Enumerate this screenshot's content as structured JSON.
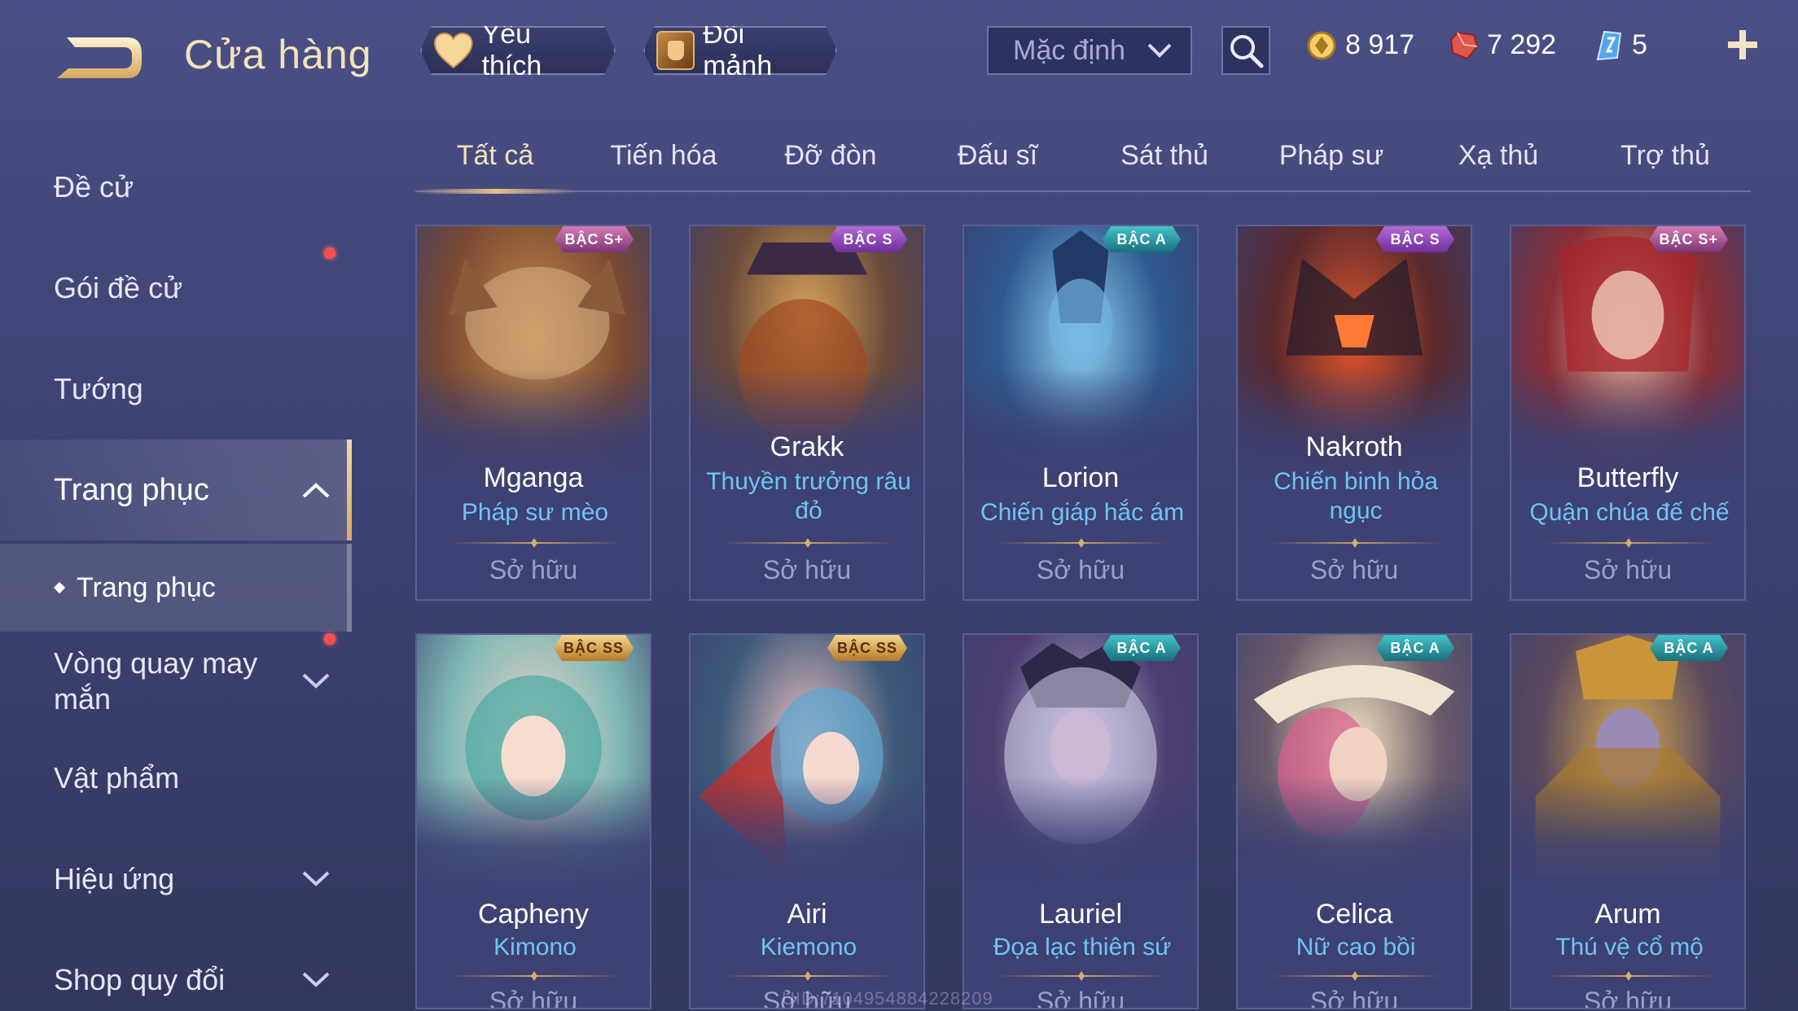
{
  "header": {
    "title": "Cửa hàng",
    "favorites_label": "Yêu thích",
    "fragments_label": "Đổi mảnh",
    "sort_selected": "Mặc định",
    "currencies": [
      {
        "icon": "gold-coin-icon",
        "value": "8 917"
      },
      {
        "icon": "ruby-icon",
        "value": "7 292"
      },
      {
        "icon": "crystal-icon",
        "value": "5"
      }
    ]
  },
  "sidebar": {
    "items": [
      {
        "label": "Đề cử"
      },
      {
        "label": "Gói đề cử",
        "dot": true
      },
      {
        "label": "Tướng"
      },
      {
        "label": "Trang phục",
        "expanded": true
      },
      {
        "label": "Vòng quay may mắn",
        "dot": true
      },
      {
        "label": "Vật phẩm"
      },
      {
        "label": "Hiệu ứng"
      },
      {
        "label": "Shop quy đổi"
      }
    ],
    "sub_active": "Trang phục"
  },
  "tabs": [
    "Tất cả",
    "Tiến hóa",
    "Đỡ đòn",
    "Đấu sĩ",
    "Sát thủ",
    "Pháp sư",
    "Xạ thủ",
    "Trợ thủ"
  ],
  "active_tab": "Tất cả",
  "cards": [
    {
      "badge": "BẬC S+",
      "hero": "Mganga",
      "skin": "Pháp sư mèo",
      "status": "Sở hữu",
      "badge_color": "#d77bb5"
    },
    {
      "badge": "BẬC S",
      "hero": "Grakk",
      "skin": "Thuyền trưởng râu đỏ",
      "status": "Sở hữu",
      "badge_color": "#b36ad6"
    },
    {
      "badge": "BẬC A",
      "hero": "Lorion",
      "skin": "Chiến giáp hắc ám",
      "status": "Sở hữu",
      "badge_color": "#43c3c8"
    },
    {
      "badge": "BẬC S",
      "hero": "Nakroth",
      "skin": "Chiến binh hỏa ngục",
      "status": "Sở hữu",
      "badge_color": "#b36ad6"
    },
    {
      "badge": "BẬC S+",
      "hero": "Butterfly",
      "skin": "Quận chúa đế chế",
      "status": "Sở hữu",
      "badge_color": "#d77bb5"
    },
    {
      "badge": "BẬC SS",
      "hero": "Capheny",
      "skin": "Kimono",
      "status": "Sở hữu",
      "badge_color": "#f5d78a"
    },
    {
      "badge": "BẬC SS",
      "hero": "Airi",
      "skin": "Kiemono",
      "status": "Sở hữu",
      "badge_color": "#f5d78a"
    },
    {
      "badge": "BẬC A",
      "hero": "Lauriel",
      "skin": "Đọa lạc thiên sứ",
      "status": "Sở hữu",
      "badge_color": "#43c3c8"
    },
    {
      "badge": "BẬC A",
      "hero": "Celica",
      "skin": "Nữ cao bồi",
      "status": "Sở hữu",
      "badge_color": "#43c3c8"
    },
    {
      "badge": "BẬC A",
      "hero": "Arum",
      "skin": "Thú vệ cổ mộ",
      "status": "Sở hữu",
      "badge_color": "#43c3c8"
    }
  ],
  "watermark": "UID:7104954884228209"
}
